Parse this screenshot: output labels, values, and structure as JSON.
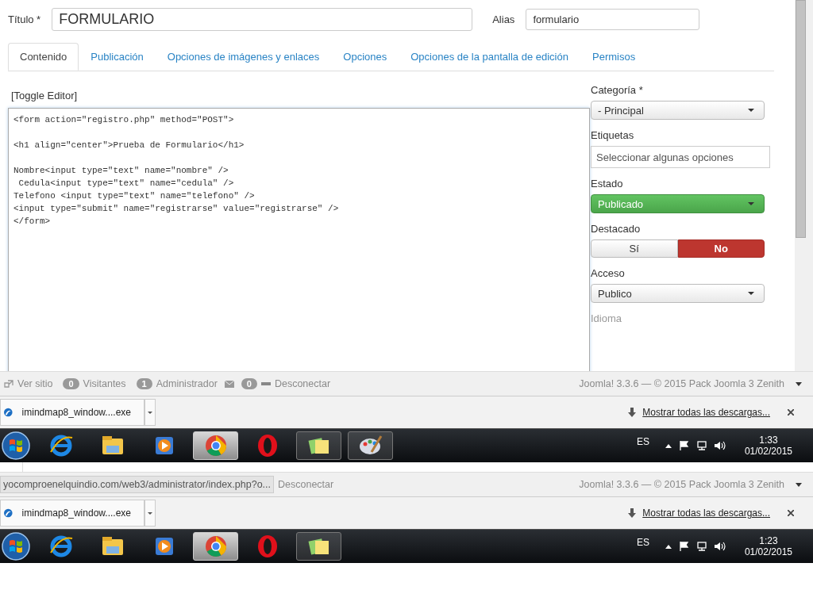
{
  "title_field": {
    "label": "Título *",
    "value": "FORMULARIO"
  },
  "alias_field": {
    "label": "Alias",
    "value": "formulario"
  },
  "tabs": [
    {
      "label": "Contenido",
      "selected": true
    },
    {
      "label": "Publicación",
      "selected": false
    },
    {
      "label": "Opciones de imágenes y enlaces",
      "selected": false
    },
    {
      "label": "Opciones",
      "selected": false
    },
    {
      "label": "Opciones de la pantalla de edición",
      "selected": false
    },
    {
      "label": "Permisos",
      "selected": false
    }
  ],
  "toggle_editor": "[Toggle Editor]",
  "editor": {
    "blocks": [
      [
        "<form action=\"registro.php\" method=\"POST\">"
      ],
      [
        "<h1 align=\"center\">Prueba de Formulario</h1>"
      ],
      [
        "Nombre<input type=\"text\" name=\"nombre\" />",
        " Cedula<input type=\"text\" name=\"cedula\" />",
        "Telefono <input type=\"text\" name=\"telefono\" />",
        "<input type=\"submit\" name=\"registrarse\" value=\"registrarse\" />",
        "</form>"
      ]
    ]
  },
  "sidebar": [
    {
      "kind": "select",
      "label": "Categoría *",
      "value": "- Principal"
    },
    {
      "kind": "tags",
      "label": "Etiquetas",
      "placeholder": "Seleccionar algunas opciones"
    },
    {
      "kind": "status-select",
      "label": "Estado",
      "value": "Publicado"
    },
    {
      "kind": "toggle",
      "label": "Destacado",
      "options": [
        {
          "label": "Sí",
          "selected": false
        },
        {
          "label": "No",
          "selected": true
        }
      ]
    },
    {
      "kind": "select",
      "label": "Acceso",
      "value": "Publico"
    },
    {
      "kind": "heading",
      "label": "Idioma"
    }
  ],
  "screens": [
    {
      "footer": {
        "left": [
          {
            "kind": "link",
            "text": "Ver sitio"
          },
          {
            "kind": "count",
            "count": "0",
            "text": "Visitantes"
          },
          {
            "kind": "count",
            "count": "1",
            "text": "Administrador"
          },
          {
            "kind": "mail",
            "count": "0"
          },
          {
            "kind": "logout",
            "text": "Desconectar"
          }
        ],
        "right": "Joomla! 3.3.6  —  © 2015 Pack Joomla 3 Zenith"
      },
      "download": {
        "file": "imindmap8_window....exe",
        "show_all": "Mostrar todas las descargas..."
      },
      "taskbar": {
        "apps": [
          {
            "kind": "ie",
            "running": false,
            "selected": false
          },
          {
            "kind": "explorer",
            "running": false,
            "selected": false
          },
          {
            "kind": "media",
            "running": false,
            "selected": false
          },
          {
            "kind": "chrome",
            "running": true,
            "selected": true
          },
          {
            "kind": "opera",
            "running": false,
            "selected": false
          },
          {
            "kind": "notes",
            "running": true,
            "selected": false
          },
          {
            "kind": "paint",
            "running": true,
            "selected": false
          }
        ],
        "lang": "ES",
        "time": "1:33",
        "date": "01/02/2015"
      }
    },
    {
      "footer": {
        "url": "yocomproenelquindio.com/web3/administrator/index.php?o...",
        "left": [
          {
            "kind": "logout-text",
            "text": "Desconectar"
          }
        ],
        "right": "Joomla! 3.3.6  —  © 2015 Pack Joomla 3 Zenith"
      },
      "download": {
        "file": "imindmap8_window....exe",
        "show_all": "Mostrar todas las descargas..."
      },
      "taskbar": {
        "apps": [
          {
            "kind": "ie",
            "running": false,
            "selected": false
          },
          {
            "kind": "explorer",
            "running": false,
            "selected": false
          },
          {
            "kind": "media",
            "running": false,
            "selected": false
          },
          {
            "kind": "chrome",
            "running": true,
            "selected": true
          },
          {
            "kind": "opera",
            "running": false,
            "selected": false
          },
          {
            "kind": "notes",
            "running": true,
            "selected": false
          }
        ],
        "lang": "ES",
        "time": "1:23",
        "date": "01/02/2015"
      }
    }
  ]
}
